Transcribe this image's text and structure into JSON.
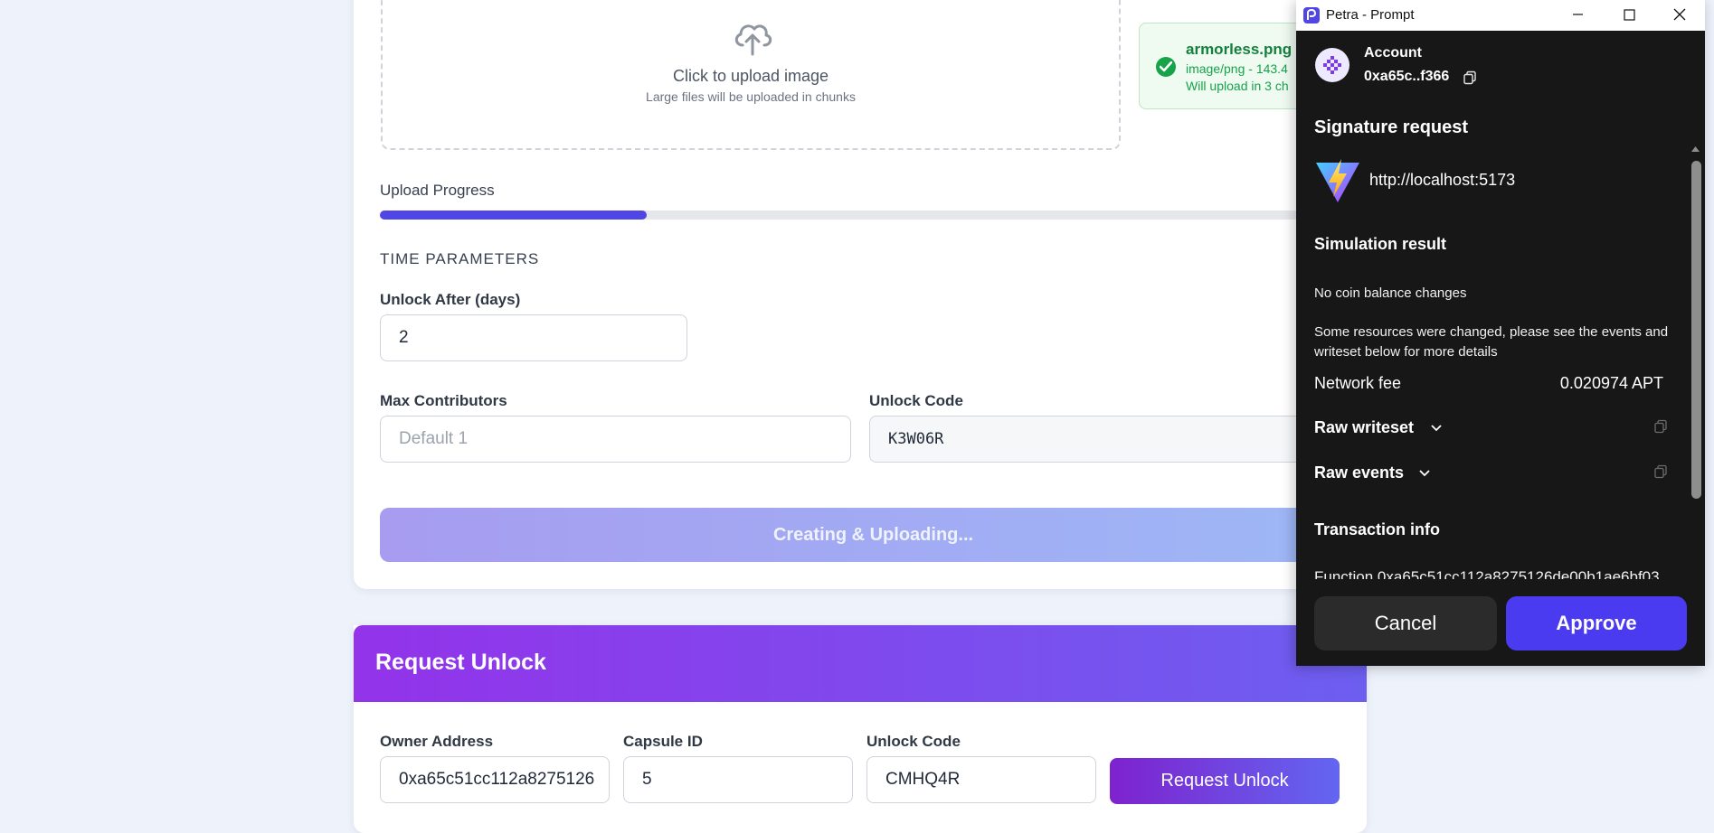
{
  "upload": {
    "title": "Click to upload image",
    "subtitle": "Large files will be uploaded in chunks"
  },
  "file": {
    "name": "armorless.png",
    "meta": "image/png - 143.4",
    "chunks": "Will upload in 3 ch"
  },
  "progress": {
    "label": "Upload Progress",
    "fraction": 0.27
  },
  "time_params": {
    "heading": "TIME PARAMETERS",
    "unlock_after_label": "Unlock After (days)",
    "unlock_after_value": "2",
    "max_contributors_label": "Max Contributors",
    "max_contributors_placeholder": "Default 1",
    "unlock_code_label": "Unlock Code",
    "unlock_code_value": "K3W06R"
  },
  "create_button": "Creating & Uploading...",
  "request_unlock": {
    "title": "Request Unlock",
    "owner_label": "Owner Address",
    "owner_value": "0xa65c51cc112a8275126",
    "capsule_label": "Capsule ID",
    "capsule_value": "5",
    "code_label": "Unlock Code",
    "code_value": "CMHQ4R",
    "button": "Request Unlock"
  },
  "petra": {
    "window_title": "Petra - Prompt",
    "account_label": "Account",
    "account_address": "0xa65c..f366",
    "signature_title": "Signature request",
    "origin": "http://localhost:5173",
    "simulation_title": "Simulation result",
    "no_coin": "No coin balance changes",
    "resources_note": "Some resources were changed, please see the events and writeset below for more details",
    "fee_label": "Network fee",
    "fee_value": "0.020974 APT",
    "raw_writeset": "Raw writeset",
    "raw_events": "Raw events",
    "tx_info": "Transaction info",
    "function_line": "Function  0xa65c51cc112a8275126de00b1ae6bf03",
    "cancel": "Cancel",
    "approve": "Approve"
  },
  "colors": {
    "accent": "#4f46e5",
    "success": "#16a34a",
    "petra_bg": "#171717",
    "approve": "#4a3af0"
  }
}
